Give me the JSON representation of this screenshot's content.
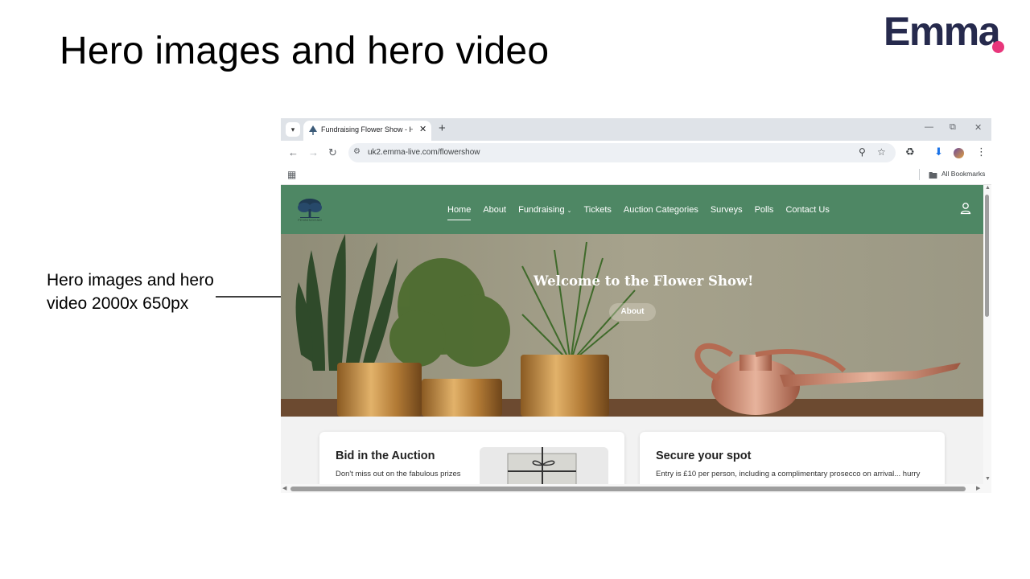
{
  "slide": {
    "title": "Hero images and hero video",
    "side_label": "Hero images and hero video 2000x 650px",
    "logo_text": "Emma",
    "logo_accent_color": "#e8367b"
  },
  "browser": {
    "tab_title": "Fundraising Flower Show - Hon",
    "url": "uk2.emma-live.com/flowershow",
    "bookmarks_label": "All Bookmarks"
  },
  "site": {
    "nav": [
      {
        "label": "Home",
        "active": true
      },
      {
        "label": "About"
      },
      {
        "label": "Fundraising",
        "has_dropdown": true
      },
      {
        "label": "Tickets"
      },
      {
        "label": "Auction Categories"
      },
      {
        "label": "Surveys"
      },
      {
        "label": "Polls"
      },
      {
        "label": "Contact Us"
      }
    ],
    "nav_color": "#4e8764",
    "hero_title": "Welcome to the Flower Show!",
    "hero_button": "About",
    "cards": [
      {
        "title": "Bid in the Auction",
        "text": "Don't miss out on the fabulous prizes"
      },
      {
        "title": "Secure your spot",
        "text": "Entry is £10 per person, including a complimentary prosecco on arrival... hurry"
      }
    ]
  }
}
